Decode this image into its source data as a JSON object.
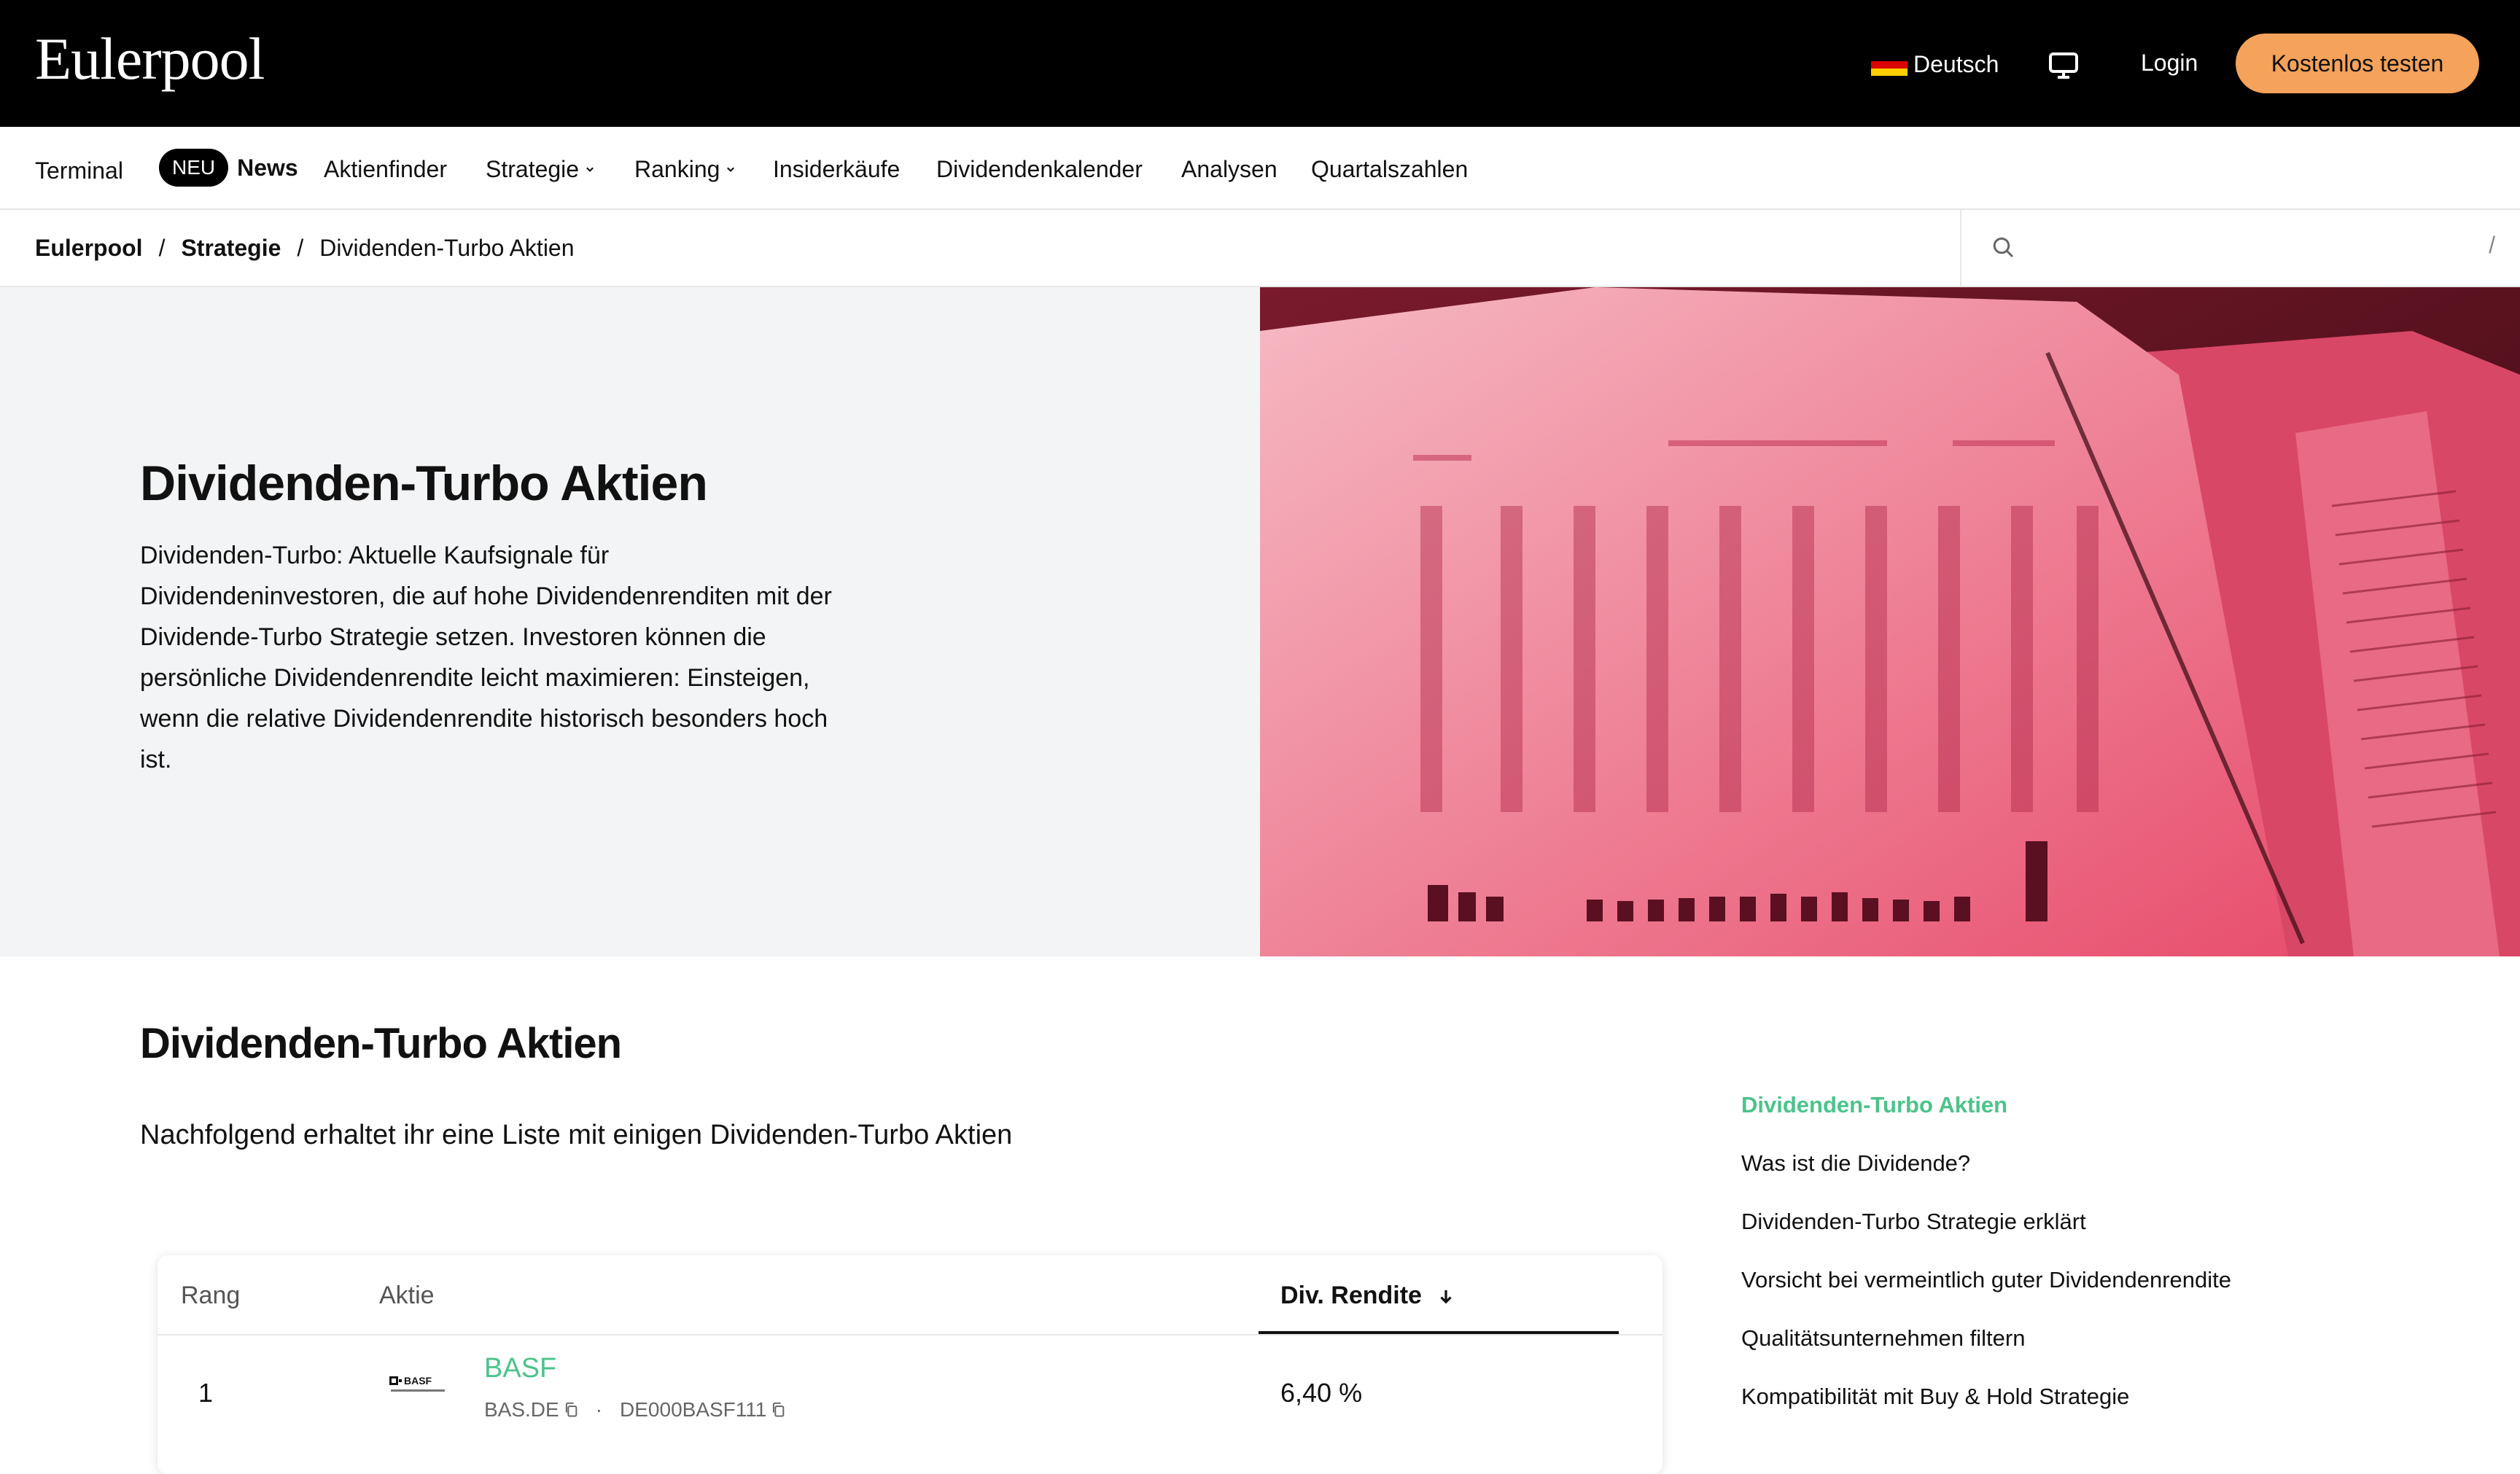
{
  "header": {
    "logo": "Eulerpool",
    "language": "Deutsch",
    "login": "Login",
    "cta": "Kostenlos testen"
  },
  "nav": {
    "terminal": "Terminal",
    "badge": "NEU",
    "news": "News",
    "aktienfinder": "Aktienfinder",
    "strategie": "Strategie",
    "ranking": "Ranking",
    "insiderkaeufe": "Insiderkäufe",
    "dividendenkalender": "Dividendenkalender",
    "analysen": "Analysen",
    "quartalszahlen": "Quartalszahlen"
  },
  "breadcrumb": {
    "home": "Eulerpool",
    "sep": "/",
    "section": "Strategie",
    "current": "Dividenden-Turbo Aktien"
  },
  "search": {
    "shortcut": "/"
  },
  "hero": {
    "title": "Dividenden-Turbo Aktien",
    "text": "Dividenden-Turbo: Aktuelle Kaufsignale für Dividendeninvestoren, die auf hohe Dividendenrenditen mit der Dividende-Turbo Strategie setzen. Investoren können die persönliche Dividendenrendite leicht maximieren: Einsteigen, wenn die relative Dividendenrendite historisch besonders hoch ist."
  },
  "main": {
    "title": "Dividenden-Turbo Aktien",
    "subtitle": "Nachfolgend erhaltet ihr eine Liste mit einigen Dividenden-Turbo Aktien"
  },
  "table": {
    "headers": {
      "rank": "Rang",
      "stock": "Aktie",
      "yield": "Div. Rendite"
    },
    "rows": [
      {
        "rank": "1",
        "logo_text": "BASF",
        "name": "BASF",
        "ticker": "BAS.DE",
        "dot": "·",
        "isin": "DE000BASF111",
        "yield": "6,40 %"
      }
    ]
  },
  "toc": {
    "items": [
      "Dividenden-Turbo Aktien",
      "Was ist die Dividende?",
      "Dividenden-Turbo Strategie erklärt",
      "Vorsicht bei vermeintlich guter Dividendenrendite",
      "Qualitätsunternehmen filtern",
      "Kompatibilität mit Buy & Hold Strategie"
    ]
  },
  "colors": {
    "cta": "#f5a25a",
    "accent_green": "#4cc38a",
    "hero_tint": "#e8506f"
  }
}
